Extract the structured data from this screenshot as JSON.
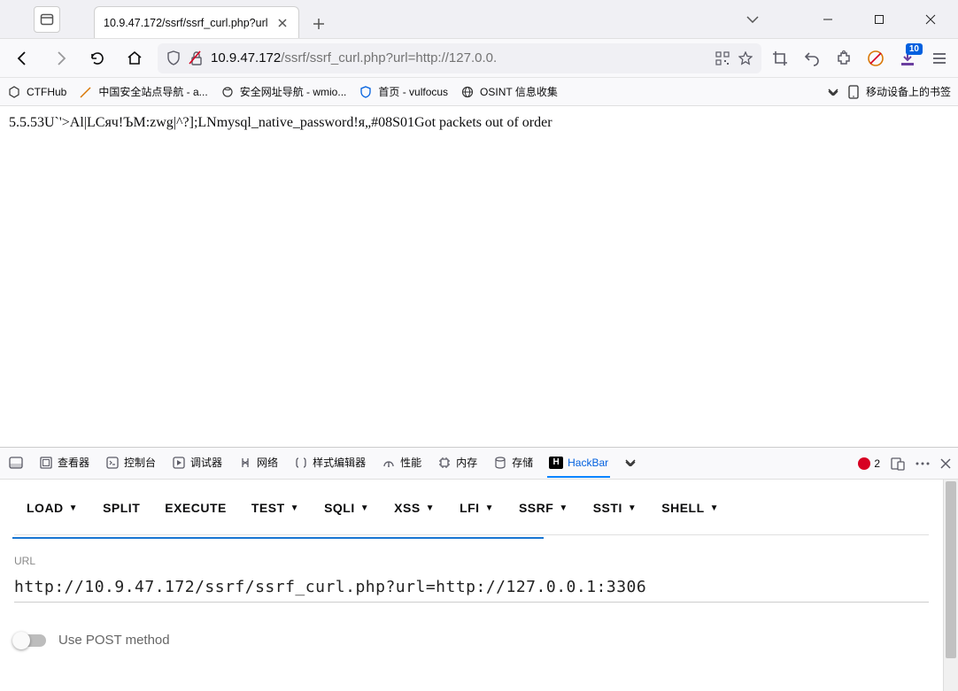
{
  "tab": {
    "title": "10.9.47.172/ssrf/ssrf_curl.php?url"
  },
  "url": {
    "host": "10.9.47.172",
    "path": "/ssrf/ssrf_curl.php?url=http://127.0.0."
  },
  "bookmarks": [
    {
      "label": "CTFHub"
    },
    {
      "label": "中国安全站点导航 - a..."
    },
    {
      "label": "安全网址导航 - wmio..."
    },
    {
      "label": "首页 - vulfocus"
    },
    {
      "label": "OSINT 信息收集"
    }
  ],
  "mobile_bookmarks": "移动设备上的书签",
  "error_count": "2",
  "download_badge": "10",
  "page_content": "5.5.53U`'>Al|LCяч!ЪM:zwg|^?];LNmysql_native_password!я„#08S01Got packets out of order",
  "devtools_tabs": {
    "inspector": "查看器",
    "console": "控制台",
    "debugger": "调试器",
    "network": "网络",
    "style": "样式编辑器",
    "performance": "性能",
    "memory": "内存",
    "storage": "存储",
    "hackbar": "HackBar"
  },
  "hackbar": {
    "actions": {
      "load": "LOAD",
      "split": "SPLIT",
      "execute": "EXECUTE",
      "test": "TEST",
      "sqli": "SQLI",
      "xss": "XSS",
      "lfi": "LFI",
      "ssrf": "SSRF",
      "ssti": "SSTI",
      "shell": "SHELL"
    },
    "url_label": "URL",
    "url_value": "http://10.9.47.172/ssrf/ssrf_curl.php?url=http://127.0.0.1:3306",
    "post_label": "Use POST method"
  }
}
